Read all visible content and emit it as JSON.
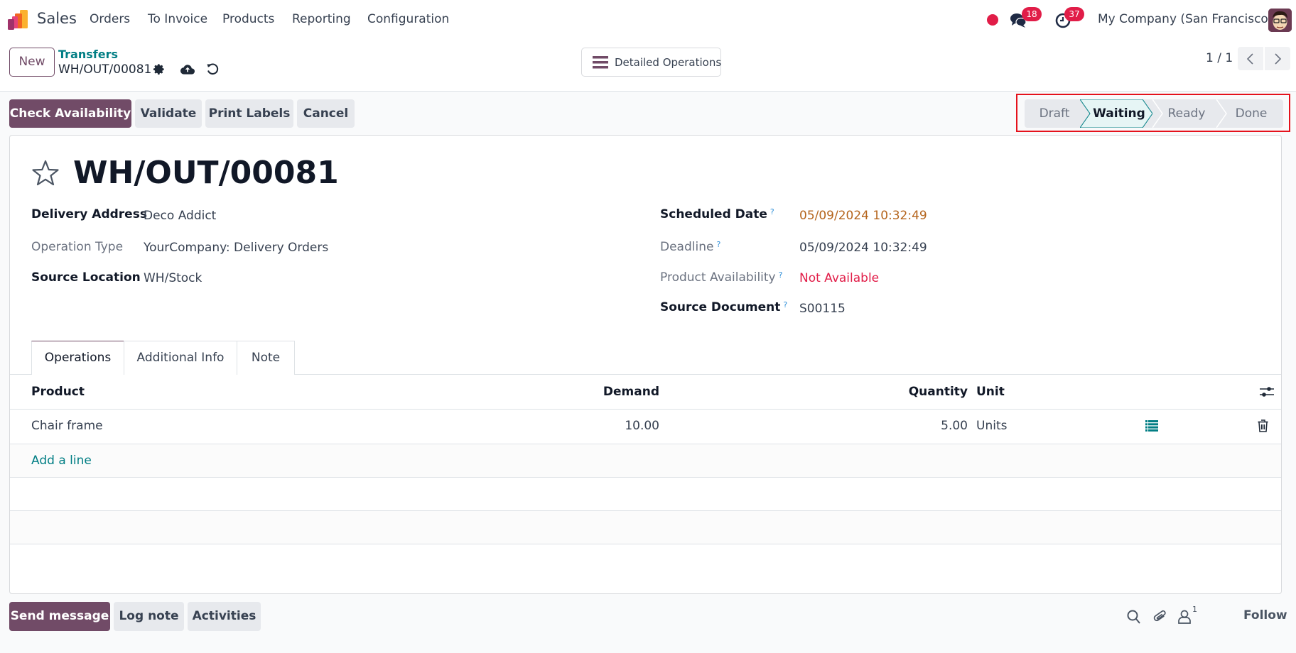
{
  "navbar": {
    "app_name": "Sales",
    "menu": [
      "Orders",
      "To Invoice",
      "Products",
      "Reporting",
      "Configuration"
    ],
    "messages_count": "18",
    "activities_count": "37",
    "company": "My Company (San Francisco)"
  },
  "control_panel": {
    "new_label": "New",
    "breadcrumb_parent": "Transfers",
    "breadcrumb_current": "WH/OUT/00081",
    "detailed_operations_label": "Detailed Operations",
    "pager": "1 / 1"
  },
  "actions": {
    "check_availability": "Check Availability",
    "validate": "Validate",
    "print_labels": "Print Labels",
    "cancel": "Cancel"
  },
  "statusbar": {
    "stages": [
      "Draft",
      "Waiting",
      "Ready",
      "Done"
    ],
    "current": "Waiting"
  },
  "record": {
    "title": "WH/OUT/00081",
    "left_fields": [
      {
        "label": "Delivery Address",
        "value": "Deco Addict"
      },
      {
        "label": "Operation Type",
        "value": "YourCompany: Delivery Orders"
      },
      {
        "label": "Source Location",
        "value": "WH/Stock"
      }
    ],
    "right_fields": [
      {
        "label": "Scheduled Date",
        "help": "?",
        "value": "05/09/2024 10:32:49"
      },
      {
        "label": "Deadline",
        "help": "?",
        "value": "05/09/2024 10:32:49"
      },
      {
        "label": "Product Availability",
        "help": "?",
        "value": "Not Available"
      },
      {
        "label": "Source Document",
        "help": "?",
        "value": "S00115"
      }
    ]
  },
  "colors": {
    "primary": "#714b67",
    "link": "#017e84",
    "scheduled_date": "#b5651d",
    "not_available": "#e11d48",
    "highlight": "#e5121c"
  },
  "tabs": [
    "Operations",
    "Additional Info",
    "Note"
  ],
  "operations_table": {
    "columns": [
      "Product",
      "Demand",
      "Quantity",
      "Unit"
    ],
    "rows": [
      {
        "product": "Chair frame",
        "demand": "10.00",
        "quantity": "5.00",
        "unit": "Units"
      }
    ],
    "add_line": "Add a line"
  },
  "chatter": {
    "send_message": "Send message",
    "log_note": "Log note",
    "activities": "Activities",
    "followers_count": "1",
    "follow": "Follow"
  }
}
